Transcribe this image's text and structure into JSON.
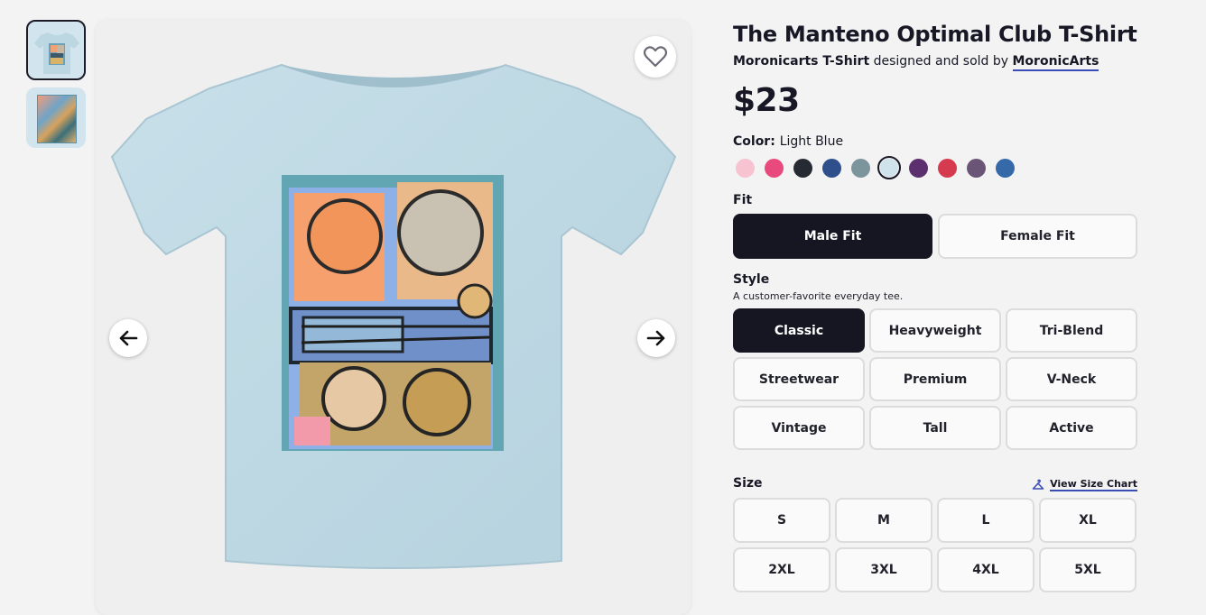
{
  "product": {
    "title": "The Manteno Optimal Club T-Shirt",
    "product_type": "Moronicarts T-Shirt",
    "byline_text": "designed and sold by",
    "artist": "MoronicArts",
    "price": "$23"
  },
  "color": {
    "label": "Color:",
    "selected": "Light Blue",
    "swatches": [
      "#f8c3d1",
      "#e84a7e",
      "#262a33",
      "#2e4f8b",
      "#7c949c",
      "#cfe3ec",
      "#5c2f6e",
      "#d63a4e",
      "#6a5577",
      "#3569a8"
    ],
    "selected_index": 5
  },
  "fit": {
    "label": "Fit",
    "options": [
      "Male Fit",
      "Female Fit"
    ],
    "selected_index": 0
  },
  "style": {
    "label": "Style",
    "description": "A customer-favorite everyday tee.",
    "options": [
      "Classic",
      "Heavyweight",
      "Tri-Blend",
      "Streetwear",
      "Premium",
      "V-Neck",
      "Vintage",
      "Tall",
      "Active"
    ],
    "selected_index": 0
  },
  "size": {
    "label": "Size",
    "chart_link": "View Size Chart",
    "options": [
      "S",
      "M",
      "L",
      "XL",
      "2XL",
      "3XL",
      "4XL",
      "5XL"
    ]
  },
  "icons": {
    "favorite": "heart-icon",
    "prev": "arrow-left-icon",
    "next": "arrow-right-icon",
    "size_chart": "hanger-icon"
  },
  "colors": {
    "text": "#171725",
    "accent_underline": "#3a4cb5",
    "selected_button": "#161622"
  }
}
